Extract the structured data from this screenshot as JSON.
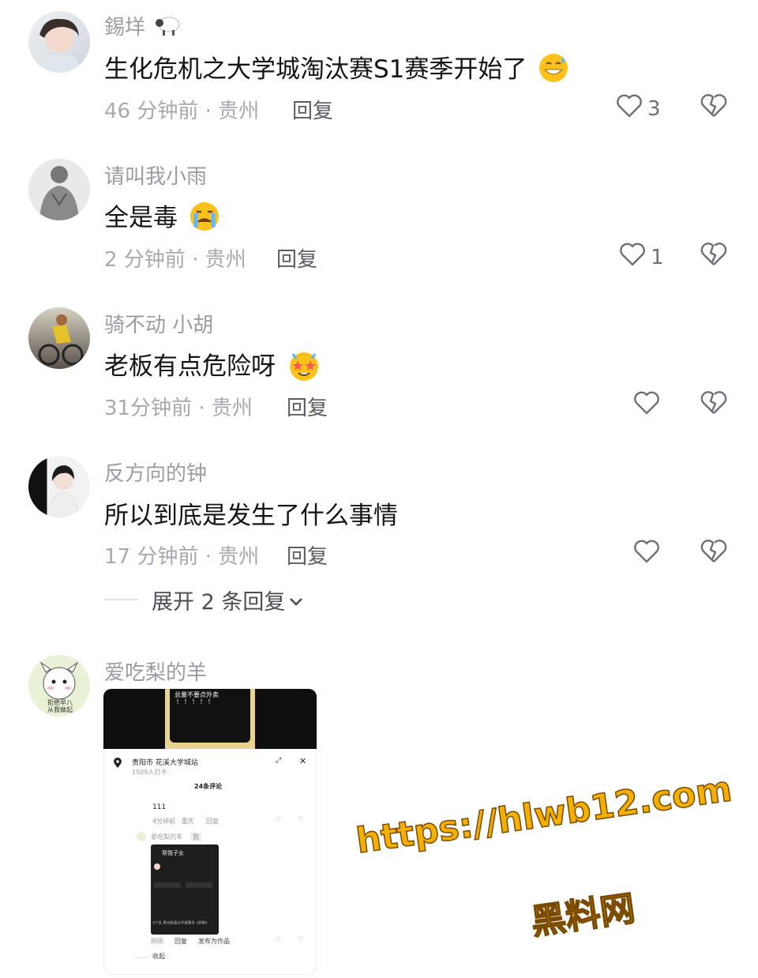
{
  "comments": [
    {
      "user": "錫垟",
      "name_emoji": "sheep-emoji",
      "text": "生化危机之大学城淘汰赛S1赛季开始了",
      "text_emoji": "grinning-sweat-emoji",
      "time": "46 分钟前 · 贵州",
      "reply": "回复",
      "likes": "3"
    },
    {
      "user": "请叫我小雨",
      "text": "全是毒",
      "text_emoji": "crying-emoji",
      "time": "2 分钟前 · 贵州",
      "reply": "回复",
      "likes": "1"
    },
    {
      "user": "骑不动 小胡",
      "text": "老板有点危险呀",
      "text_emoji": "star-struck-emoji",
      "time": "31分钟前 · 贵州",
      "reply": "回复",
      "likes": ""
    },
    {
      "user": "反方向的钟",
      "text": "所以到底是发生了什么事情",
      "time": "17 分钟前 · 贵州",
      "reply": "回复",
      "likes": ""
    }
  ],
  "expand_replies": "展开 2 条回复",
  "last_comment": {
    "user": "爱吃梨的羊",
    "avatar_caption": "拒绝早八\n从我做起"
  },
  "embedded_screenshot": {
    "video_caption": "总量不要点外卖",
    "video_exclaim": "！！！！！",
    "location": "贵阳市 花溪大学城站",
    "checkins": "1509人打卡",
    "comment_count": "24条评论",
    "c1_text": "111",
    "c1_meta": "4分钟前 · 重庆",
    "c1_reply": "回复",
    "c2_user": "爱吃梨的羊",
    "c2_badge": "我",
    "mini_title": "帮我子女",
    "mini_caption": "3个女 贵州花溪大学城事件《恐怖》",
    "c2_meta": "刚刚",
    "c2_reply": "回复",
    "c2_publish": "发布为作品",
    "collapse": "收起"
  },
  "watermark": {
    "url": "https://hlwb12.com",
    "site": "黑料网"
  },
  "colors": {
    "name": "#9a9ca3",
    "text": "#141414",
    "meta": "#a7a9af",
    "watermark": "#f4b000"
  }
}
